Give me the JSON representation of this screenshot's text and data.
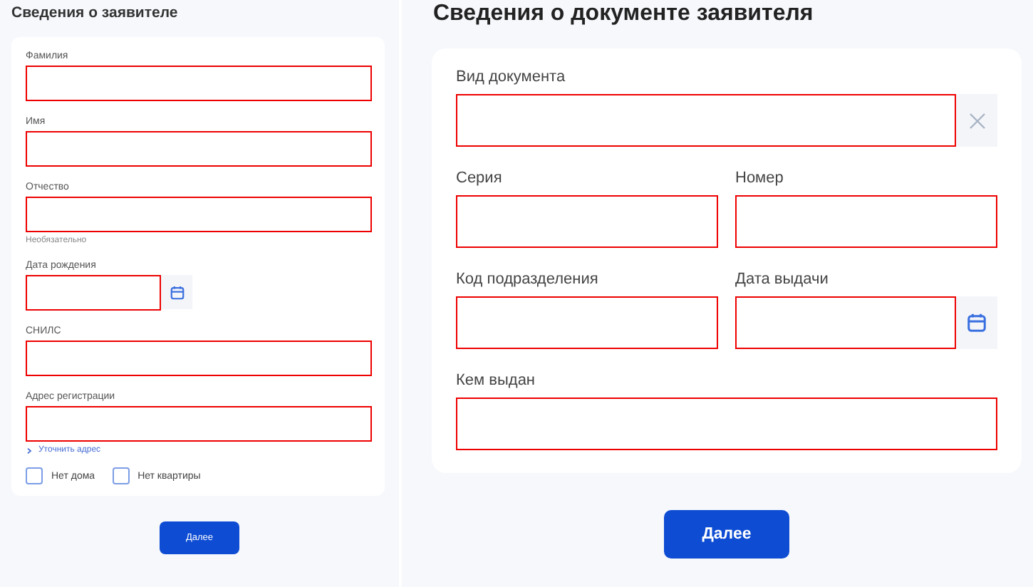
{
  "left": {
    "title": "Сведения о заявителе",
    "fields": [
      {
        "kind": "text",
        "label": "Фамилия"
      },
      {
        "kind": "text",
        "label": "Имя"
      },
      {
        "kind": "text",
        "label": "Отчество",
        "hint": "Необязательно"
      },
      {
        "kind": "date",
        "label": "Дата рождения"
      },
      {
        "kind": "text",
        "label": "СНИЛС"
      },
      {
        "kind": "text",
        "label": "Адрес регистрации",
        "link": "Уточнить адрес"
      }
    ],
    "checkboxes": [
      {
        "label": "Нет дома",
        "checked": false
      },
      {
        "label": "Нет квартиры",
        "checked": false
      }
    ],
    "button": "Далее"
  },
  "right": {
    "title": "Сведения о документе заявителя",
    "rows": [
      [
        {
          "kind": "select",
          "label": "Вид документа"
        }
      ],
      [
        {
          "kind": "text",
          "label": "Серия"
        },
        {
          "kind": "text",
          "label": "Номер"
        }
      ],
      [
        {
          "kind": "text",
          "label": "Код подразделения"
        },
        {
          "kind": "date",
          "label": "Дата выдачи"
        }
      ],
      [
        {
          "kind": "text",
          "label": "Кем выдан"
        }
      ]
    ],
    "button": "Далее"
  }
}
